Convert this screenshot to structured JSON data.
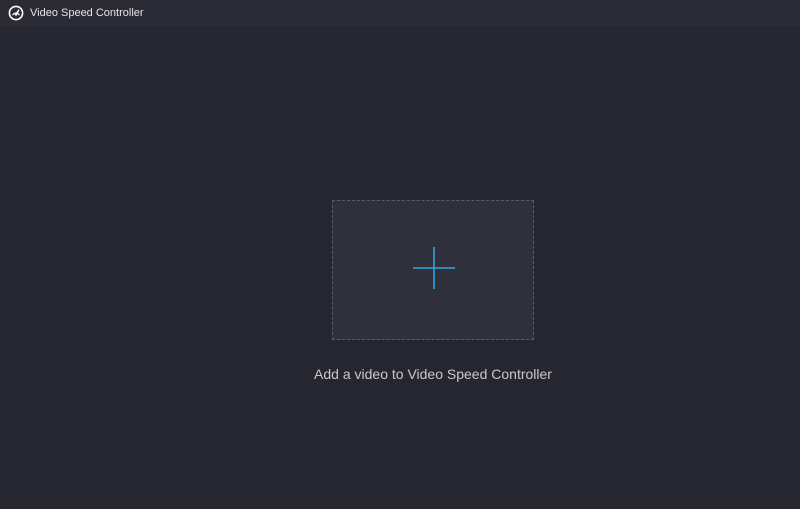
{
  "window": {
    "title": "Video Speed Controller",
    "app_icon": "speedometer-icon"
  },
  "drop_zone": {
    "icon": "plus-icon",
    "label": "Add a video to Video Speed Controller"
  },
  "colors": {
    "background": "#262631",
    "titlebar": "#2b2b36",
    "drop_zone_fill": "#30303c",
    "drop_zone_border": "#5c5c68",
    "accent": "#2ea6e6",
    "title_text": "#e4e4e8",
    "label_text": "#c8c8ce"
  }
}
